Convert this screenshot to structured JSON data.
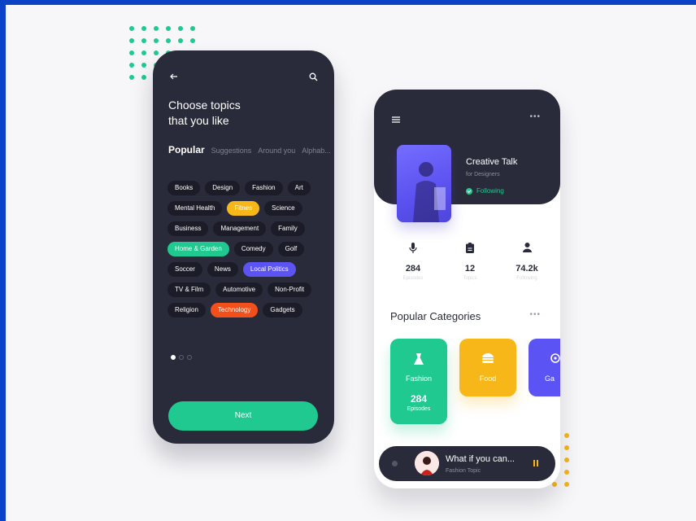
{
  "colors": {
    "dark": "#2a2b3a",
    "green": "#1fc98f",
    "yellow": "#f7b719",
    "blue": "#5b53f3",
    "orange": "#f2501b"
  },
  "topics": {
    "title": "Choose topics\nthat you like",
    "tabs": [
      "Popular",
      "Suggestions",
      "Around you",
      "Alphab..."
    ],
    "active_tab": "Popular",
    "chip_rows": [
      [
        {
          "label": "Books",
          "color": "dark"
        },
        {
          "label": "Design",
          "color": "dark"
        },
        {
          "label": "Fashion",
          "color": "dark"
        },
        {
          "label": "Art",
          "color": "dark"
        }
      ],
      [
        {
          "label": "Mental Health",
          "color": "dark"
        },
        {
          "label": "Fitnes",
          "color": "yellow"
        },
        {
          "label": "Science",
          "color": "dark"
        }
      ],
      [
        {
          "label": "Business",
          "color": "dark"
        },
        {
          "label": "Management",
          "color": "dark"
        },
        {
          "label": "Family",
          "color": "dark"
        }
      ],
      [
        {
          "label": "Home & Garden",
          "color": "green"
        },
        {
          "label": "Comedy",
          "color": "dark"
        },
        {
          "label": "Golf",
          "color": "dark"
        }
      ],
      [
        {
          "label": "Soccer",
          "color": "dark"
        },
        {
          "label": "News",
          "color": "dark"
        },
        {
          "label": "Local Politics",
          "color": "blue"
        }
      ],
      [
        {
          "label": "TV & Film",
          "color": "dark"
        },
        {
          "label": "Automotive",
          "color": "dark"
        },
        {
          "label": "Non-Profit",
          "color": "dark"
        }
      ],
      [
        {
          "label": "Religion",
          "color": "dark"
        },
        {
          "label": "Technology",
          "color": "orange"
        },
        {
          "label": "Gadgets",
          "color": "dark"
        }
      ]
    ],
    "page_count": 3,
    "current_page": 1,
    "next_label": "Next"
  },
  "profile": {
    "title": "Creative Talk",
    "subtitle": "for Designers",
    "follow_status": "Following",
    "stats": [
      {
        "icon": "microphone-icon",
        "value": "284",
        "label": "Episodes"
      },
      {
        "icon": "clipboard-icon",
        "value": "12",
        "label": "Topics"
      },
      {
        "icon": "person-icon",
        "value": "74.2k",
        "label": "Following"
      }
    ],
    "categories_title": "Popular Categories",
    "categories": [
      {
        "name": "Fashion",
        "icon": "dress-icon",
        "color": "green",
        "count": "284",
        "unit": "Episodes"
      },
      {
        "name": "Food",
        "icon": "burger-icon",
        "color": "yellow"
      },
      {
        "name": "Ga",
        "icon": "gaming-icon",
        "color": "blue"
      }
    ],
    "player": {
      "title": "What if you can...",
      "subtitle": "Fashion Topic"
    }
  }
}
